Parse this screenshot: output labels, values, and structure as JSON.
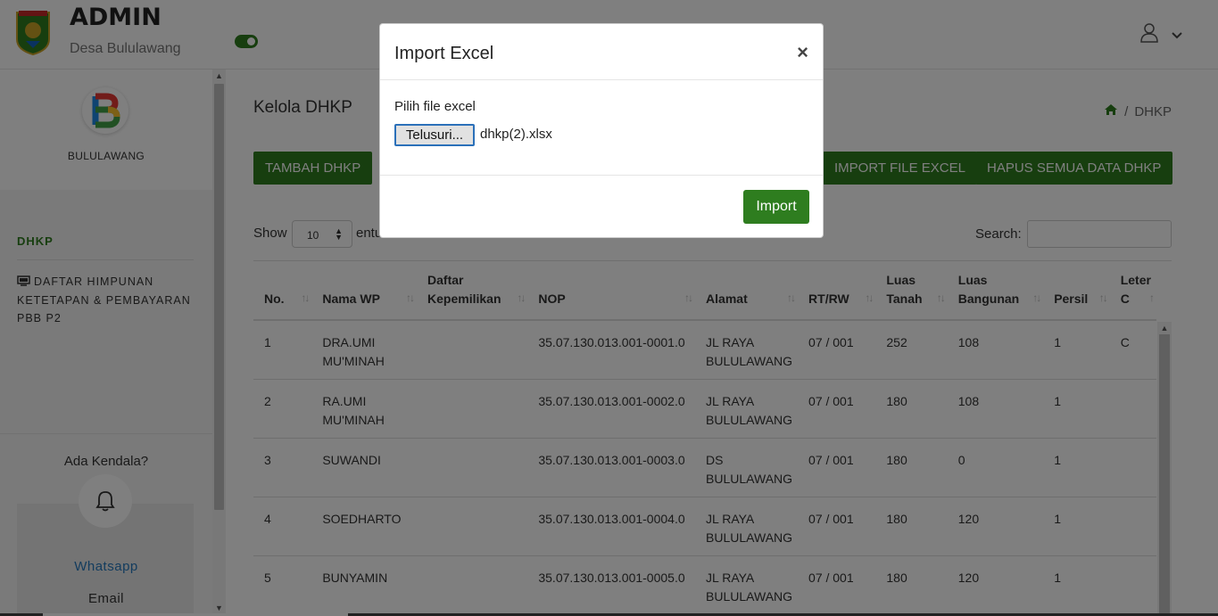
{
  "header": {
    "title": "ADMIN",
    "subtitle": "Desa Bululawang",
    "logo_icon": "regency-crest-icon",
    "user_icon": "user-icon",
    "caret_icon": "chevron-down-icon"
  },
  "sidebar": {
    "profile_name": "BULULAWANG",
    "nav_heading": "DHKP",
    "nav_items": [
      {
        "label": "DAFTAR HIMPUNAN KETETAPAN & PEMBAYARAN PBB P2",
        "icon": "monitor-icon"
      }
    ],
    "help_title": "Ada Kendala?",
    "help_icon": "bell-icon",
    "help_whatsapp": "Whatsapp",
    "help_email": "Email"
  },
  "main": {
    "page_title": "Kelola DHKP",
    "breadcrumb_current": "DHKP",
    "buttons": {
      "add": "TAMBAH DHKP",
      "import": "IMPORT FILE EXCEL",
      "delete_all": "HAPUS SEMUA DATA DHKP"
    },
    "length": {
      "show": "Show",
      "value": "10",
      "suffix": "entu"
    },
    "search_label": "Search:",
    "table": {
      "headers": [
        "No.",
        "Nama WP",
        "Daftar Kepemilikan",
        "NOP",
        "Alamat",
        "RT/RW",
        "Luas Tanah",
        "Luas Bangunan",
        "Persil",
        "Leter C"
      ],
      "rows": [
        [
          "1",
          "DRA.UMI MU'MINAH",
          "",
          "35.07.130.013.001-0001.0",
          "JL RAYA BULULAWANG",
          "07 / 001",
          "252",
          "108",
          "1",
          "C"
        ],
        [
          "2",
          "RA.UMI MU'MINAH",
          "",
          "35.07.130.013.001-0002.0",
          "JL RAYA BULULAWANG",
          "07 / 001",
          "180",
          "108",
          "1",
          ""
        ],
        [
          "3",
          "SUWANDI",
          "",
          "35.07.130.013.001-0003.0",
          "DS BULULAWANG",
          "07 / 001",
          "180",
          "0",
          "1",
          ""
        ],
        [
          "4",
          "SOEDHARTO",
          "",
          "35.07.130.013.001-0004.0",
          "JL RAYA BULULAWANG",
          "07 / 001",
          "180",
          "120",
          "1",
          ""
        ],
        [
          "5",
          "BUNYAMIN",
          "",
          "35.07.130.013.001-0005.0",
          "JL RAYA BULULAWANG",
          "07 / 001",
          "180",
          "120",
          "1",
          ""
        ]
      ]
    }
  },
  "modal": {
    "title": "Import Excel",
    "close": "×",
    "file_label": "Pilih file excel",
    "browse_label": "Telusuri...",
    "file_name": "dhkp(2).xlsx",
    "submit": "Import"
  },
  "colors": {
    "accent": "#2e7d1f",
    "link": "#2779bd"
  }
}
